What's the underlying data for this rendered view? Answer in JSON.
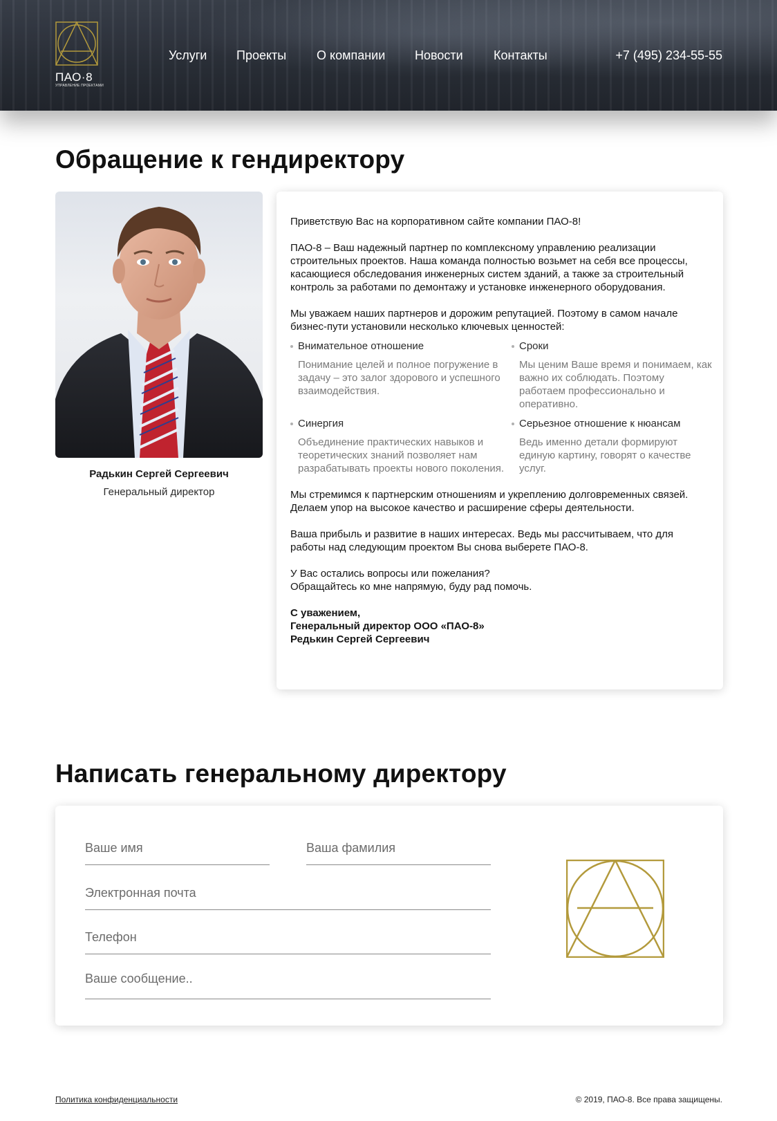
{
  "header": {
    "logo_text": "ПАО·8",
    "logo_subtitle": "УПРАВЛЕНИЕ ПРОЕКТАМИ",
    "nav": [
      "Услуги",
      "Проекты",
      "О компании",
      "Новости",
      "Контакты"
    ],
    "phone": "+7 (495) 234-55-55"
  },
  "appeal": {
    "title": "Обращение к гендиректору",
    "person_name": "Радькин Сергей Сергеевич",
    "person_role": "Генеральный директор",
    "greeting": "Приветствую Вас на корпоративном сайте компании ПАО-8!",
    "paragraph1": "ПАО-8 – Ваш надежный партнер по комплексному управлению реализации строительных проектов. Наша команда полностью возьмет на себя все процессы, касающиеся обследования инженерных систем зданий, а также за строительный контроль за работами по демонтажу и установке инженерного оборудования.",
    "paragraph2": "Мы уважаем наших партнеров и дорожим репутацией. Поэтому в самом начале бизнес-пути установили несколько ключевых ценностей:",
    "values": [
      {
        "title": "Внимательное отношение",
        "text": "Понимание целей и полное погружение в задачу – это залог здорового и успешного взаимодействия."
      },
      {
        "title": "Сроки",
        "text": "Мы ценим Ваше время и понимаем, как важно их соблюдать. Поэтому работаем профессионально и оперативно."
      },
      {
        "title": "Синергия",
        "text": "Объединение практических навыков и теоретических знаний позволяет нам разрабатывать проекты нового поколения."
      },
      {
        "title": "Серьезное отношение к нюансам",
        "text": "Ведь именно детали формируют единую картину, говорят о качестве услуг."
      }
    ],
    "paragraph3": "Мы стремимся к партнерским отношениям и укреплению долговременных связей. Делаем упор на высокое качество и расширение сферы деятельности.",
    "paragraph4": "Ваша прибыль и развитие в наших интересах. Ведь мы рассчитываем, что для работы над следующим проектом Вы снова выберете ПАО-8.",
    "paragraph5_line1": "У Вас остались вопросы или пожелания?",
    "paragraph5_line2": "Обращайтесь ко мне напрямую, буду рад помочь.",
    "sign_line1": "С уважением,",
    "sign_line2": "Генеральный директор ООО «ПАО-8»",
    "sign_line3": "Редькин Сергей Сергеевич"
  },
  "form": {
    "title": "Написать генеральному директору",
    "first_name_placeholder": "Ваше имя",
    "last_name_placeholder": "Ваша фамилия",
    "email_placeholder": "Электронная почта",
    "phone_placeholder": "Телефон",
    "message_placeholder": "Ваше сообщение.."
  },
  "footer": {
    "privacy": "Политика конфиденциальности",
    "copyright": "© 2019, ПАО-8. Все права защищены."
  },
  "colors": {
    "gold": "#b39a3c",
    "header_dark": "#2a2f38"
  }
}
